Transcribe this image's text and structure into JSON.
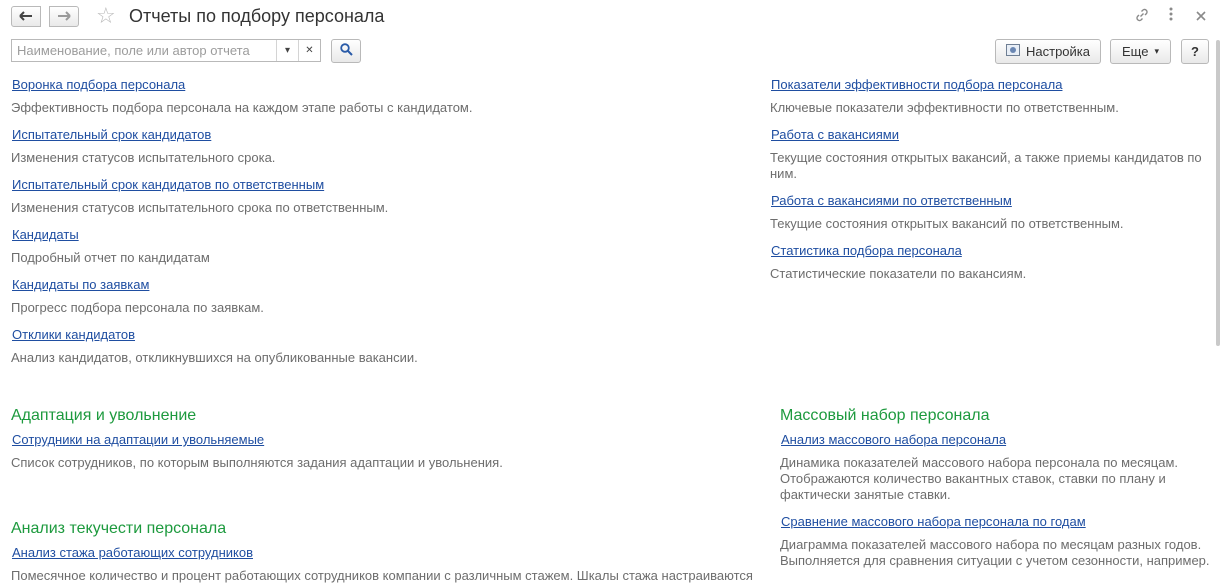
{
  "header": {
    "title": "Отчеты по подбору персонала"
  },
  "search": {
    "placeholder": "Наименование, поле или автор отчета",
    "value": ""
  },
  "toolbar": {
    "settings_label": "Настройка",
    "more_label": "Еще",
    "help_label": "?"
  },
  "left_column": {
    "reports": [
      {
        "title": "Воронка подбора персонала",
        "description": "Эффективность подбора персонала на каждом этапе работы с кандидатом."
      },
      {
        "title": "Испытательный срок кандидатов",
        "description": "Изменения статусов испытательного срока."
      },
      {
        "title": "Испытательный срок кандидатов по ответственным",
        "description": "Изменения статусов испытательного срока по ответственным."
      },
      {
        "title": "Кандидаты",
        "description": "Подробный отчет по кандидатам"
      },
      {
        "title": "Кандидаты по заявкам",
        "description": "Прогресс подбора персонала по заявкам."
      },
      {
        "title": "Отклики кандидатов",
        "description": "Анализ кандидатов, откликнувшихся на опубликованные вакансии."
      }
    ]
  },
  "right_column": {
    "reports": [
      {
        "title": "Показатели эффективности подбора персонала",
        "description": "Ключевые показатели эффективности по ответственным."
      },
      {
        "title": "Работа с вакансиями",
        "description": "Текущие состояния открытых вакансий, а также приемы кандидатов по ним."
      },
      {
        "title": "Работа с вакансиями по ответственным",
        "description": "Текущие состояния открытых вакансий по ответственным."
      },
      {
        "title": "Статистика подбора персонала",
        "description": "Статистические показатели по вакансиям."
      }
    ]
  },
  "groups": {
    "adaptation": {
      "title": "Адаптация и увольнение",
      "reports": [
        {
          "title": "Сотрудники на адаптации и увольняемые",
          "description": "Список сотрудников, по которым выполняются задания адаптации и увольнения."
        }
      ]
    },
    "turnover": {
      "title": "Анализ текучести персонала",
      "reports": [
        {
          "title": "Анализ стажа работающих сотрудников",
          "description": "Помесячное количество и процент работающих сотрудников компании с различным стажем. Шкалы стажа настраиваются"
        }
      ]
    },
    "mass": {
      "title": "Массовый набор персонала",
      "reports": [
        {
          "title": "Анализ массового набора персонала",
          "description": "Динамика показателей массового набора персонала по месяцам. Отображаются количество вакантных ставок, ставки по плану и фактически занятые ставки."
        },
        {
          "title": "Сравнение массового набора персонала по годам",
          "description": "Диаграмма показателей массового набора по месяцам разных годов. Выполняется для сравнения ситуации с учетом сезонности, например."
        }
      ]
    }
  },
  "colors": {
    "link": "#1f4ea1",
    "group_title": "#1d9a3e",
    "description": "#6d6d6d"
  }
}
